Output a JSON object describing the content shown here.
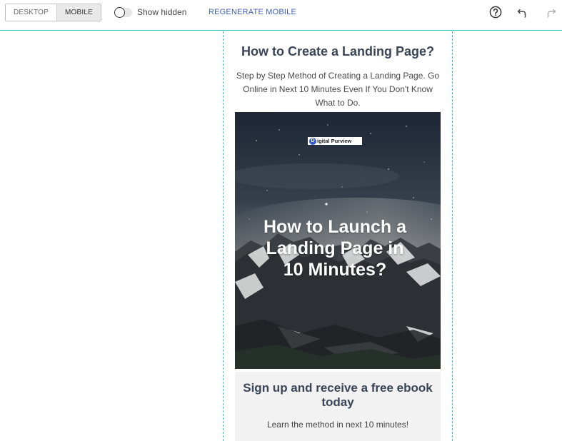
{
  "toolbar": {
    "view_modes": [
      {
        "label": "DESKTOP",
        "active": false
      },
      {
        "label": "MOBILE",
        "active": true
      }
    ],
    "show_hidden": {
      "label": "Show hidden",
      "enabled": false
    },
    "regenerate_label": "REGENERATE MOBILE",
    "icons": [
      "help-icon",
      "undo-icon",
      "redo-icon"
    ]
  },
  "page": {
    "heading": "How to Create a Landing Page?",
    "subtext": "Step by Step Method of Creating a Landing Page. Go Online in Next 10 Minutes Even If You Don't Know What to Do.",
    "hero": {
      "logo_letter": "D",
      "logo_text": "igital Purview",
      "title": "How to Launch a Landing Page in 10 Minutes?"
    },
    "signup": {
      "title": "Sign up and receive a free ebook today",
      "subtitle": "Learn the method in next 10 minutes!"
    }
  },
  "colors": {
    "accent_guides": "#35c6c6",
    "link_blue": "#3d5fb8",
    "heading": "#3a4558",
    "signup_bg": "#f2f2f2"
  }
}
